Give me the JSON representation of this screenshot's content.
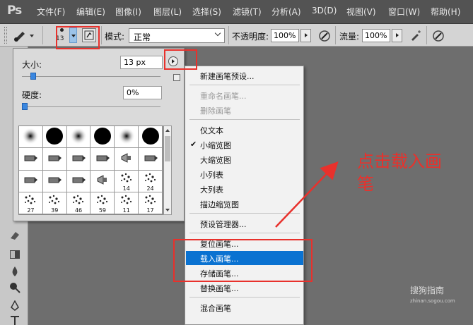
{
  "app": {
    "logo": "Ps"
  },
  "menubar": {
    "items": [
      "文件(F)",
      "编辑(E)",
      "图像(I)",
      "图层(L)",
      "选择(S)",
      "滤镜(T)",
      "分析(A)",
      "3D(D)",
      "视图(V)",
      "窗口(W)",
      "帮助(H)"
    ]
  },
  "options": {
    "brush_size_value": "13",
    "mode_label": "模式:",
    "mode_value": "正常",
    "opacity_label": "不透明度:",
    "opacity_value": "100%",
    "flow_label": "流量:",
    "flow_value": "100%"
  },
  "brush_panel": {
    "size_label": "大小:",
    "size_value": "13 px",
    "hardness_label": "硬度:",
    "hardness_value": "0%",
    "size_slider": 0.06,
    "hardness_slider": 0.0,
    "thumbnails": [
      {
        "kind": "soft",
        "num": ""
      },
      {
        "kind": "hard",
        "num": ""
      },
      {
        "kind": "soft",
        "num": ""
      },
      {
        "kind": "hard",
        "num": ""
      },
      {
        "kind": "soft",
        "num": ""
      },
      {
        "kind": "hard",
        "num": ""
      },
      {
        "kind": "tip",
        "num": ""
      },
      {
        "kind": "tip",
        "num": ""
      },
      {
        "kind": "tip",
        "num": ""
      },
      {
        "kind": "tip",
        "num": ""
      },
      {
        "kind": "cone",
        "num": ""
      },
      {
        "kind": "tip",
        "num": ""
      },
      {
        "kind": "tip",
        "num": ""
      },
      {
        "kind": "tip",
        "num": ""
      },
      {
        "kind": "tip",
        "num": ""
      },
      {
        "kind": "cone",
        "num": ""
      },
      {
        "kind": "scatter",
        "num": "14"
      },
      {
        "kind": "scatter",
        "num": "24"
      },
      {
        "kind": "scatter",
        "num": "27"
      },
      {
        "kind": "scatter",
        "num": "39"
      },
      {
        "kind": "scatter",
        "num": "46"
      },
      {
        "kind": "scatter",
        "num": "59"
      },
      {
        "kind": "scatter",
        "num": "11"
      },
      {
        "kind": "scatter",
        "num": "17"
      }
    ]
  },
  "panel_menu": {
    "items": [
      {
        "label": "新建画笔预设...",
        "state": "normal",
        "checked": false
      },
      {
        "sep": true
      },
      {
        "label": "重命名画笔...",
        "state": "disabled",
        "checked": false
      },
      {
        "label": "删除画笔",
        "state": "disabled",
        "checked": false
      },
      {
        "sep": true
      },
      {
        "label": "仅文本",
        "state": "normal",
        "checked": false
      },
      {
        "label": "小缩览图",
        "state": "normal",
        "checked": true
      },
      {
        "label": "大缩览图",
        "state": "normal",
        "checked": false
      },
      {
        "label": "小列表",
        "state": "normal",
        "checked": false
      },
      {
        "label": "大列表",
        "state": "normal",
        "checked": false
      },
      {
        "label": "描边缩览图",
        "state": "normal",
        "checked": false
      },
      {
        "sep": true
      },
      {
        "label": "预设管理器...",
        "state": "normal",
        "checked": false
      },
      {
        "sep": true
      },
      {
        "label": "复位画笔...",
        "state": "normal",
        "checked": false
      },
      {
        "label": "载入画笔...",
        "state": "active",
        "checked": false
      },
      {
        "label": "存储画笔...",
        "state": "normal",
        "checked": false
      },
      {
        "label": "替换画笔...",
        "state": "normal",
        "checked": false
      },
      {
        "sep": true
      },
      {
        "label": "混合画笔",
        "state": "normal",
        "checked": false
      }
    ]
  },
  "annotation": {
    "text_line1": "点击载入画",
    "text_line2": "笔",
    "color": "#e8312c"
  },
  "watermark": {
    "text": "搜狗指南",
    "sub": "zhinan.sogou.com"
  },
  "colors": {
    "menu_highlight": "#0a72d1",
    "slider_knob": "#3a87e0"
  }
}
